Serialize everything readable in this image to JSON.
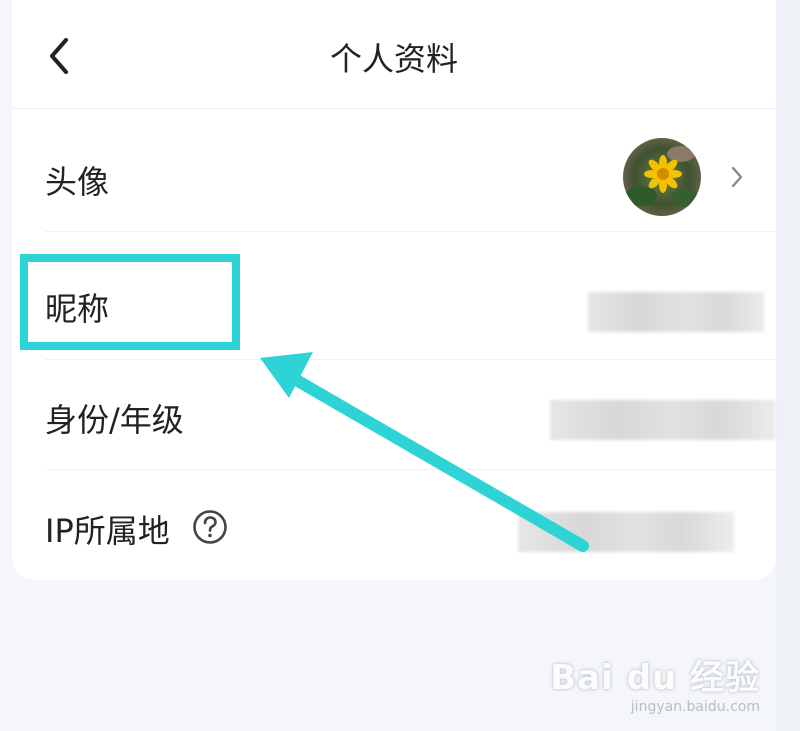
{
  "header": {
    "title": "个人资料",
    "back_icon": "chevron-left-icon"
  },
  "profile": {
    "rows": [
      {
        "label": "头像",
        "value_type": "avatar",
        "icon": "chevron-right-icon"
      },
      {
        "label": "昵称",
        "value_type": "blurred"
      },
      {
        "label": "身份/年级",
        "value_type": "blurred"
      },
      {
        "label": "IP所属地",
        "value_type": "blurred",
        "icon": "question-circle-icon"
      }
    ]
  },
  "annotation": {
    "highlight_color": "#2ed3d6",
    "target": "昵称"
  },
  "watermark": {
    "logo": "Bai du 经验",
    "url": "jingyan.baidu.com"
  }
}
